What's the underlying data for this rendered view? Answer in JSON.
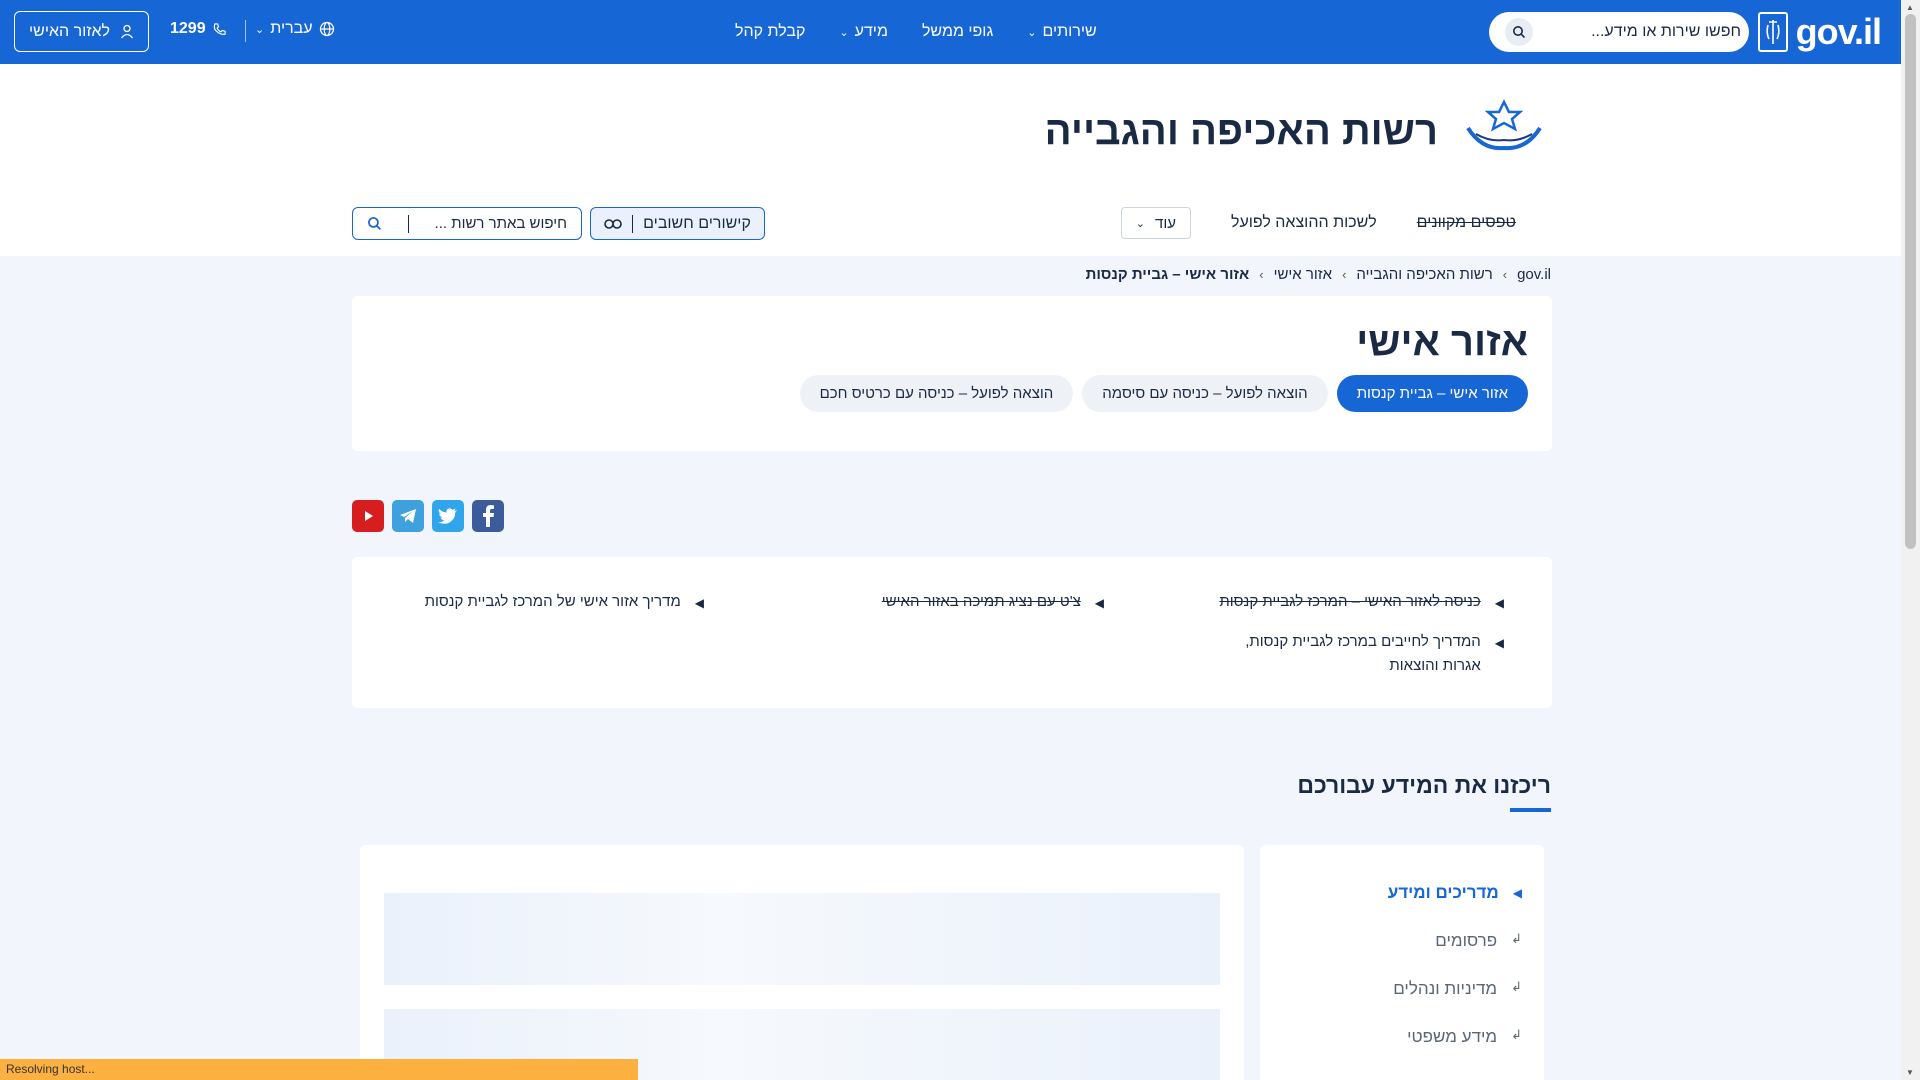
{
  "topbar": {
    "brand": "gov.il",
    "search_placeholder": "חפשו שירות או מידע...",
    "nav": [
      {
        "label": "שירותים",
        "dropdown": true
      },
      {
        "label": "גופי ממשל",
        "dropdown": false
      },
      {
        "label": "מידע",
        "dropdown": true
      },
      {
        "label": "קבלת קהל",
        "dropdown": false
      }
    ],
    "language": "עברית",
    "phone": "1299",
    "personal_area": "לאזור האישי"
  },
  "header": {
    "org_title": "רשות האכיפה והגבייה",
    "subnav": {
      "forms": "טפסים מקוונים",
      "offices": "לשכות ההוצאה לפועל",
      "more": "עוד"
    },
    "important_links": "קישורים חשובים",
    "site_search_placeholder": "חיפוש באתר רשות ..."
  },
  "breadcrumb": [
    "gov.il",
    "רשות האכיפה והגבייה",
    "אזור אישי",
    "אזור אישי – גביית קנסות"
  ],
  "title_card": {
    "title": "אזור אישי",
    "tabs": [
      {
        "label": "אזור אישי – גביית קנסות",
        "active": true
      },
      {
        "label": "הוצאה לפועל – כניסה עם סיסמה",
        "active": false
      },
      {
        "label": "הוצאה לפועל – כניסה עם כרטיס חכם",
        "active": false
      }
    ]
  },
  "social": [
    "facebook-icon",
    "twitter-icon",
    "telegram-icon",
    "youtube-icon"
  ],
  "quick_links": [
    {
      "label": "כניסה לאזור האישי – המרכז לגביית קנסות",
      "strike": true
    },
    {
      "label": "צ'ט עם נציג תמיכה באזור האישי",
      "strike": true
    },
    {
      "label": "מדריך אזור אישי של המרכז לגביית קנסות",
      "strike": false
    },
    {
      "label": "המדריך לחייבים במרכז לגביית קנסות, אגרות והוצאות",
      "strike": false
    }
  ],
  "section": {
    "title": "ריכזנו את המידע עבורכם",
    "side_items": [
      {
        "label": "מדריכים ומידע",
        "active": true
      },
      {
        "label": "פרסומים",
        "active": false
      },
      {
        "label": "מדיניות ונהלים",
        "active": false
      },
      {
        "label": "מידע משפטי",
        "active": false
      }
    ]
  },
  "status_bar": "Resolving host...",
  "colors": {
    "primary": "#1766d6",
    "background": "#f2f6fc",
    "status": "#fbb040"
  }
}
